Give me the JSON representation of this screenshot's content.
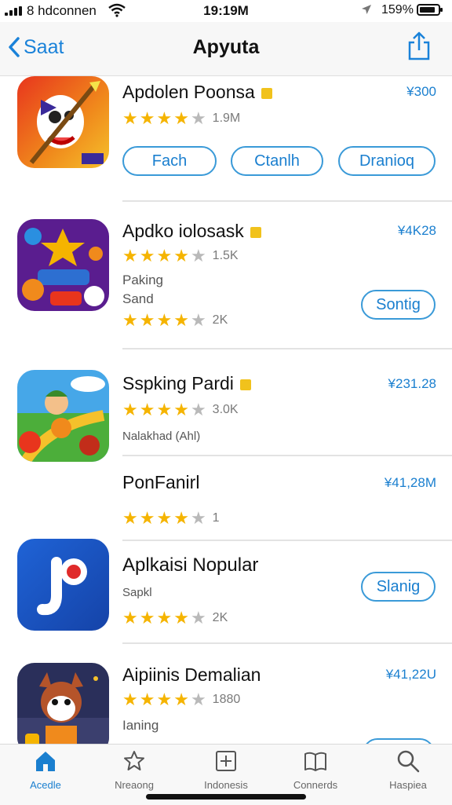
{
  "status": {
    "carrier": "8 hdconnen",
    "time": "19:19M",
    "battery_pct": "159%",
    "battery_level": 0.85,
    "icons": [
      "signal-icon",
      "wifi-icon",
      "location-icon",
      "battery-icon"
    ]
  },
  "nav": {
    "back_label": "Saat",
    "title": "Apyuta",
    "share_icon": "share-icon"
  },
  "apps": [
    {
      "title": "Apdolen Poonsa",
      "price": "¥300",
      "rating": 4,
      "count": "1.9M",
      "buttons": [
        "Fach",
        "Ctanlh",
        "Dranioq"
      ]
    },
    {
      "title": "Apdko iolosask",
      "price": "¥4K28",
      "rating": 4,
      "count": "1.5K",
      "subtitle1": "Paking",
      "subtitle2": "Sand",
      "rating2": 4,
      "count2": "2K",
      "button": "Sontig"
    },
    {
      "title": "Sspking Pardi",
      "price": "¥231.28",
      "rating": 4,
      "count": "3.0K",
      "subtitle": "Nalakhad (Ahl)"
    },
    {
      "title": "PonFanirl",
      "price": "¥41,28M",
      "rating": 4,
      "count": "1"
    },
    {
      "title": "Aplkaisi Nopular",
      "price": "",
      "subtitle": "Sapkl",
      "rating": 4,
      "count": "2K",
      "button": "Slanig"
    },
    {
      "title": "Aipiinis Demalian",
      "price": "¥41,22U",
      "rating": 4,
      "count": "1880",
      "subtitle": "Ianing"
    }
  ],
  "tabs": [
    {
      "label": "Acedle",
      "icon": "home-icon",
      "active": true
    },
    {
      "label": "Nreaong",
      "icon": "star-icon",
      "active": false
    },
    {
      "label": "Indonesis",
      "icon": "plus-square-icon",
      "active": false
    },
    {
      "label": "Connerds",
      "icon": "book-icon",
      "active": false
    },
    {
      "label": "Haspiea",
      "icon": "search-icon",
      "active": false
    }
  ],
  "colors": {
    "accent": "#1a7fcf",
    "star": "#f5b400",
    "star_off": "#b9b9b9"
  }
}
